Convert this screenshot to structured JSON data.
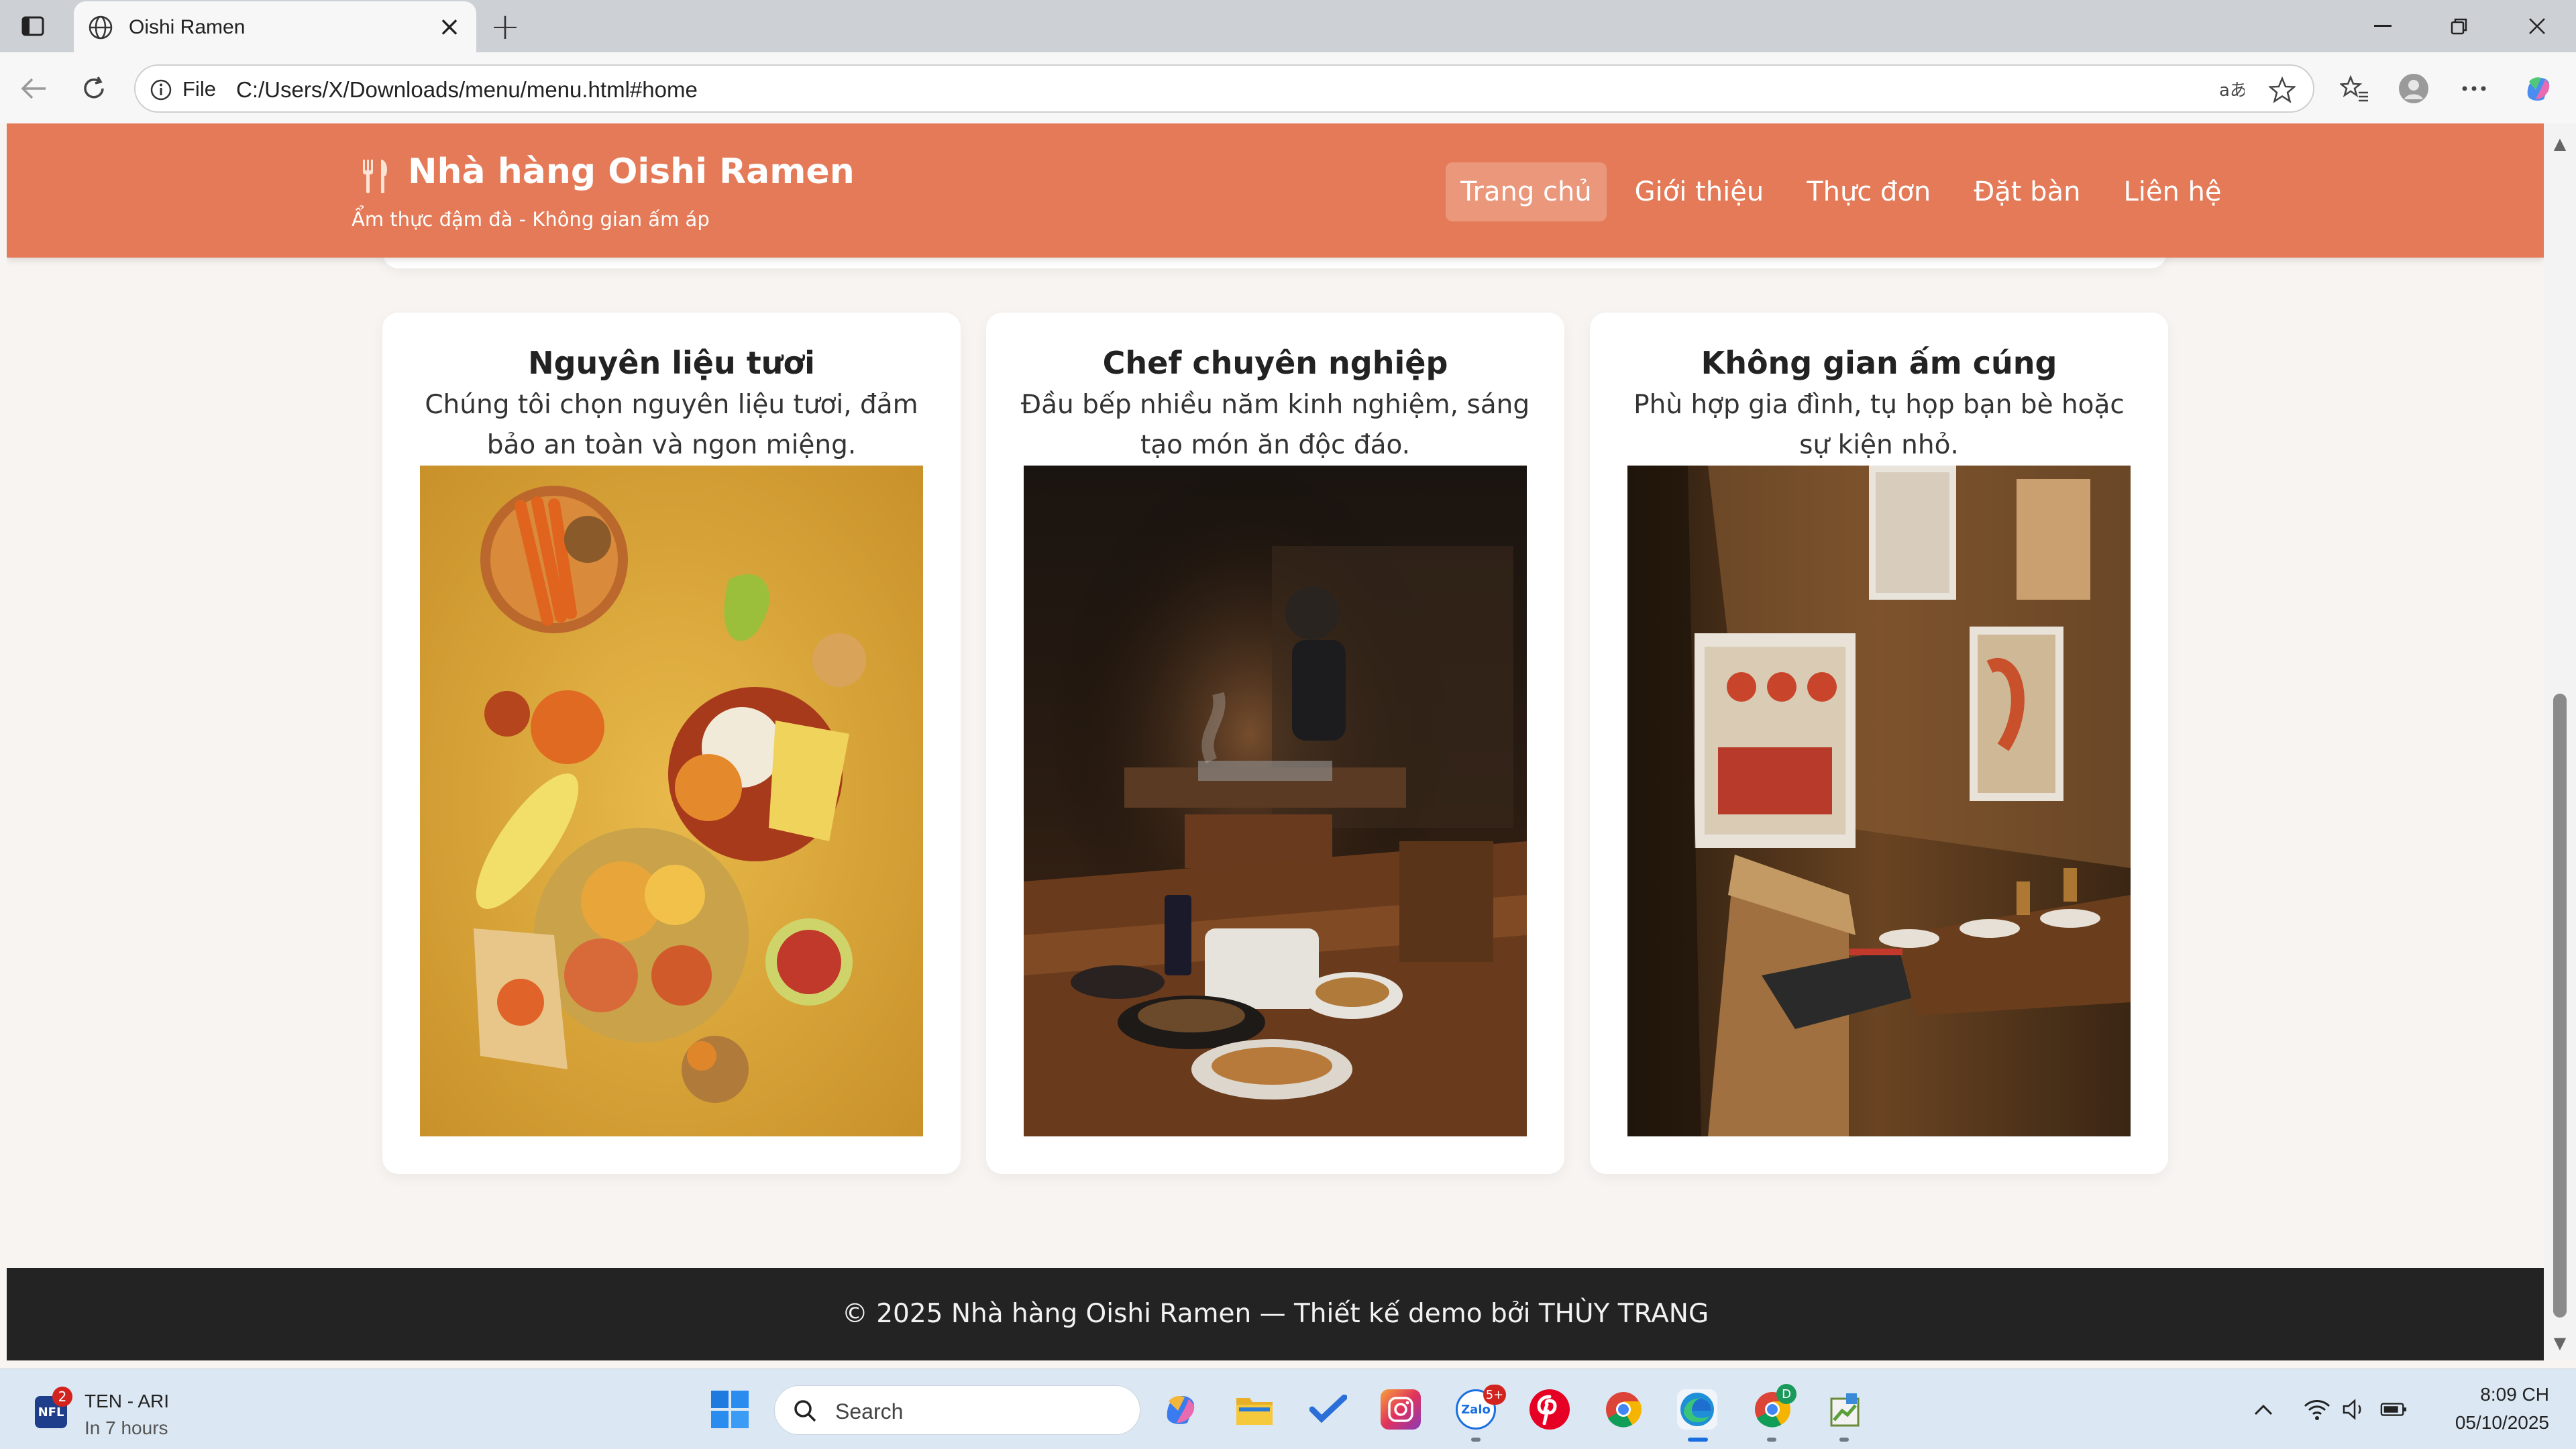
{
  "browser": {
    "tab_title": "Oishi Ramen",
    "url_scheme_label": "File",
    "url": "C:/Users/X/Downloads/menu/menu.html#home"
  },
  "site": {
    "brand_title": "Nhà hàng Oishi Ramen",
    "brand_subtitle": "Ẩm thực đậm đà - Không gian ấm áp",
    "nav": [
      {
        "label": "Trang chủ",
        "active": true
      },
      {
        "label": "Giới thiệu",
        "active": false
      },
      {
        "label": "Thực đơn",
        "active": false
      },
      {
        "label": "Đặt bàn",
        "active": false
      },
      {
        "label": "Liên hệ",
        "active": false
      }
    ],
    "accent_color": "#e47a57",
    "features": [
      {
        "title": "Nguyên liệu tươi",
        "text": "Chúng tôi chọn nguyên liệu tươi, đảm bảo an toàn và ngon miệng.",
        "image": "fresh-ingredients-photo"
      },
      {
        "title": "Chef chuyên nghiệp",
        "text": "Đầu bếp nhiều năm kinh nghiệm, sáng tạo món ăn độc đáo.",
        "image": "chef-kitchen-photo"
      },
      {
        "title": "Không gian ấm cúng",
        "text": "Phù hợp gia đình, tụ họp bạn bè hoặc sự kiện nhỏ.",
        "image": "restaurant-interior-photo"
      }
    ],
    "footer": "© 2025 Nhà hàng Oishi Ramen — Thiết kế demo bởi THÙY TRANG"
  },
  "taskbar": {
    "weather_title": "TEN - ARI",
    "weather_sub": "In 7 hours",
    "nfl_badge": "NFL",
    "nfl_count": "2",
    "search_placeholder": "Search",
    "zalo_badge": "5+",
    "zalo_label": "Zalo",
    "chrome_profile": "D",
    "time": "8:09 CH",
    "date": "05/10/2025"
  }
}
